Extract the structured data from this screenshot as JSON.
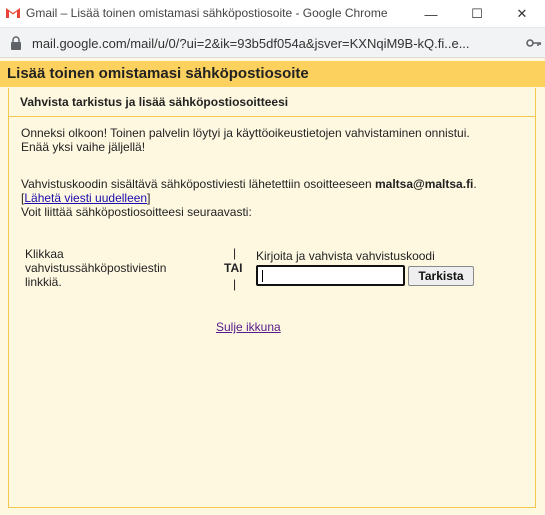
{
  "window": {
    "title": "Gmail – Lisää toinen omistamasi sähköpostiosoite - Google Chrome",
    "minimize": "—",
    "maximize": "☐",
    "close": "✕"
  },
  "address": {
    "url": "mail.google.com/mail/u/0/?ui=2&ik=93b5df054a&jsver=KXNqiM9B-kQ.fi..e..."
  },
  "page": {
    "header": "Lisää toinen omistamasi sähköpostiosoite",
    "section_title": "Vahvista tarkistus ja lisää sähköpostiosoitteesi",
    "success_line1": "Onneksi olkoon! Toinen palvelin löytyi ja käyttöoikeustietojen vahvistaminen onnistui.",
    "success_line2": "Enää yksi vaihe jäljellä!",
    "sent_prefix": "Vahvistuskoodin sisältävä sähköpostiviesti lähetettiin osoitteeseen ",
    "sent_email": "maltsa@maltsa.fi",
    "sent_suffix": ".",
    "resend_open": "[",
    "resend_link": "Lähetä viesti uudelleen",
    "resend_close": "]",
    "confirm_prompt": "Voit liittää sähköpostiosoitteesi seuraavasti:",
    "click_label_1": "Klikkaa",
    "click_label_2": "vahvistussähköpostiviestin",
    "click_label_3": "linkkiä.",
    "divider": "|",
    "or_label": "TAI",
    "code_label": "Kirjoita ja vahvista vahvistuskoodi",
    "code_value": "",
    "verify_button": "Tarkista",
    "close_link": "Sulje ikkuna"
  },
  "colors": {
    "header_bg": "#fcd15e",
    "page_bg": "#fff8e1",
    "link": "#1a0dab",
    "visited_link": "#551a8b"
  }
}
